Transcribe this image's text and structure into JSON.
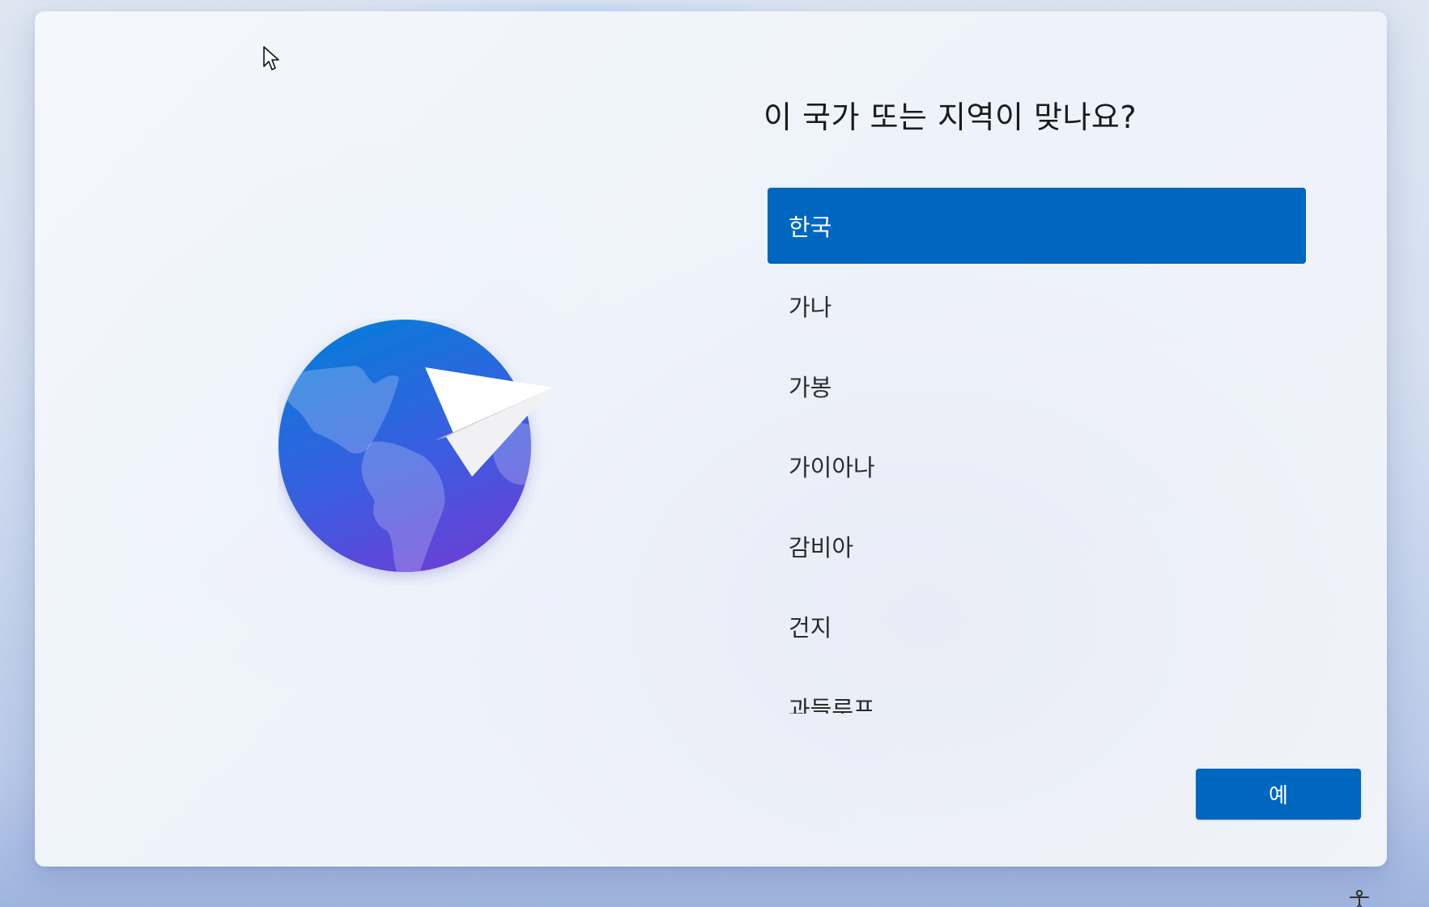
{
  "title": "이 국가 또는 지역이 맞나요?",
  "countries": [
    {
      "label": "한국",
      "selected": true
    },
    {
      "label": "가나",
      "selected": false
    },
    {
      "label": "가봉",
      "selected": false
    },
    {
      "label": "가이아나",
      "selected": false
    },
    {
      "label": "감비아",
      "selected": false
    },
    {
      "label": "건지",
      "selected": false
    },
    {
      "label": "과들루프",
      "selected": false
    }
  ],
  "confirm_label": "예",
  "colors": {
    "accent": "#0067c0",
    "globe_top": "#0a7ad9",
    "globe_bottom": "#6a3fd6"
  },
  "icons": {
    "illustration": "globe-with-paper-plane-icon",
    "cursor": "mouse-pointer-icon",
    "accessibility": "accessibility-icon"
  }
}
